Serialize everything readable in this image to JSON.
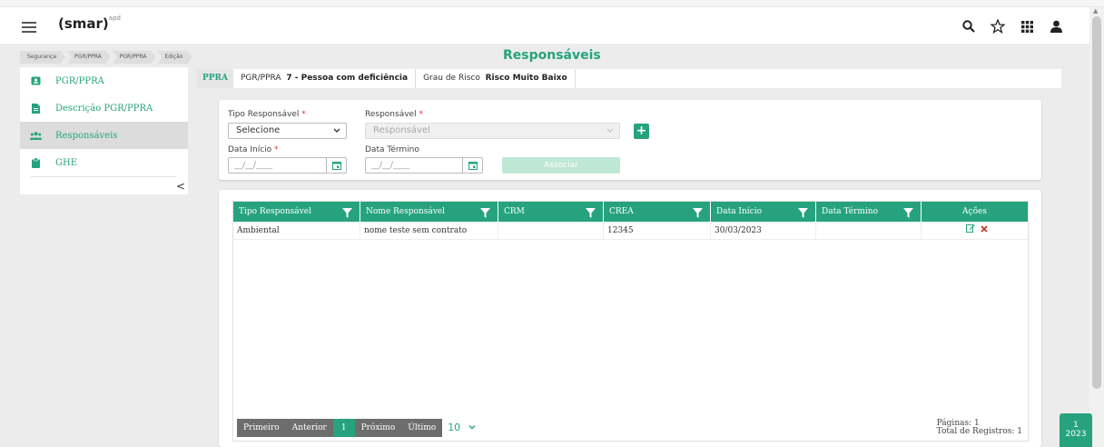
{
  "header": {
    "logo": "(smar)",
    "logo_sup": "apd"
  },
  "breadcrumb": [
    "Segurança",
    "PGR/PPRA",
    "PGR/PPRA",
    "Edição"
  ],
  "page_title": "Responsáveis",
  "sidebar": {
    "items": [
      {
        "label": "PGR/PPRA",
        "icon": "id-card-icon"
      },
      {
        "label": "Descrição PGR/PPRA",
        "icon": "document-icon"
      },
      {
        "label": "Responsáveis",
        "icon": "users-icon"
      },
      {
        "label": "GHE",
        "icon": "clipboard-icon"
      }
    ],
    "collapse_glyph": "<"
  },
  "infobar": {
    "tag": "PPRA",
    "pgr_label": "PGR/PPRA",
    "pgr_value": "7 - Pessoa com deficiência",
    "risk_label": "Grau de Risco",
    "risk_value": "Risco Muito Baixo"
  },
  "form": {
    "tipo_label": "Tipo Responsável",
    "tipo_value": "Selecione",
    "resp_label": "Responsável",
    "resp_placeholder": "Responsável",
    "inicio_label": "Data Início",
    "inicio_placeholder": "__/__/____",
    "termino_label": "Data Término",
    "termino_placeholder": "__/__/____",
    "required_mark": "*",
    "add_glyph": "+",
    "associar_label": "Associar"
  },
  "table": {
    "columns": [
      "Tipo Responsável",
      "Nome Responsável",
      "CRM",
      "CREA",
      "Data Início",
      "Data Término",
      "Ações"
    ],
    "rows": [
      {
        "tipo": "Ambiental",
        "nome": "nome teste sem contrato",
        "crm": "",
        "crea": "12345",
        "inicio": "30/03/2023",
        "termino": ""
      }
    ]
  },
  "pager": {
    "first": "Primeiro",
    "prev": "Anterior",
    "current": "1",
    "next": "Próximo",
    "last": "Último",
    "page_size": "10",
    "pages_text": "Páginas: 1",
    "total_text": "Total de Registros: 1"
  },
  "year_badge": {
    "line1": "1",
    "line2": "2023"
  },
  "colors": {
    "accent": "#26a37e",
    "accent_light": "#bfe7d6",
    "pager_gray": "#6d6d6d",
    "delete_red": "#c0392b"
  }
}
